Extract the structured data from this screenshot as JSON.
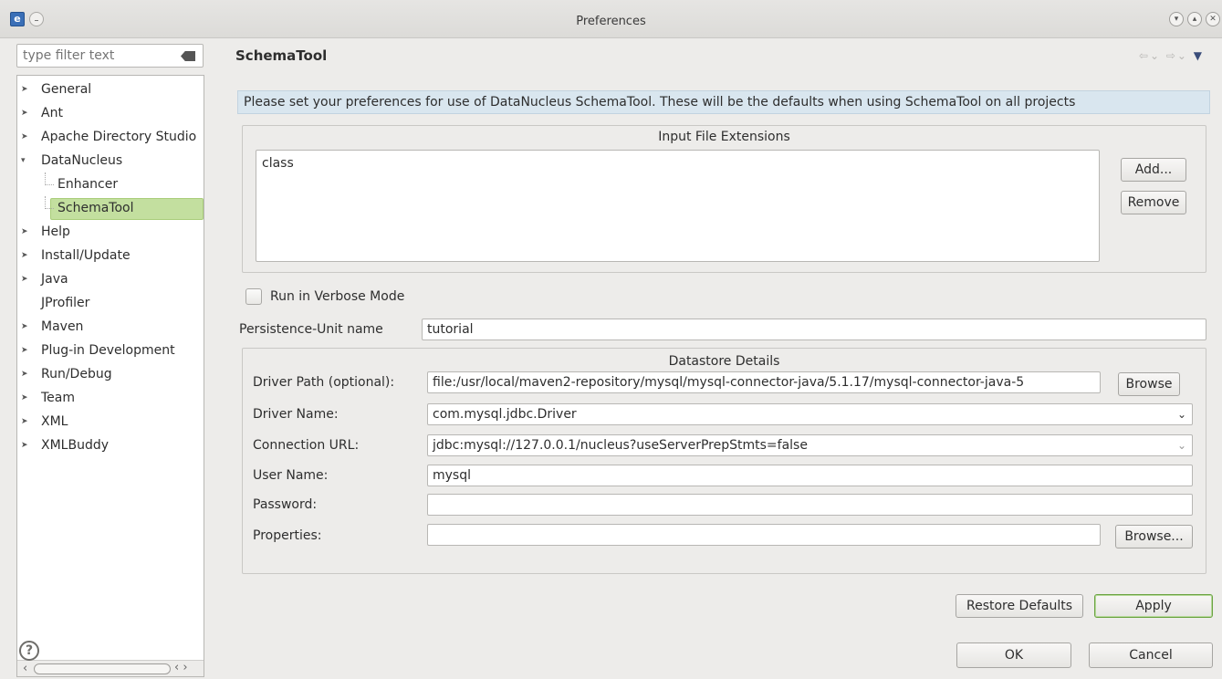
{
  "window": {
    "title": "Preferences"
  },
  "filter": {
    "placeholder": "type filter text"
  },
  "tree": {
    "items": [
      {
        "label": "General",
        "expanded": false
      },
      {
        "label": "Ant",
        "expanded": false
      },
      {
        "label": "Apache Directory Studio",
        "expanded": false
      },
      {
        "label": "DataNucleus",
        "expanded": true
      },
      {
        "label": "Enhancer",
        "child": true
      },
      {
        "label": "SchemaTool",
        "child": true,
        "selected": true
      },
      {
        "label": "Help",
        "expanded": false
      },
      {
        "label": "Install/Update",
        "expanded": false
      },
      {
        "label": "Java",
        "expanded": false
      },
      {
        "label": "JProfiler",
        "leaf": true
      },
      {
        "label": "Maven",
        "expanded": false
      },
      {
        "label": "Plug-in Development",
        "expanded": false
      },
      {
        "label": "Run/Debug",
        "expanded": false
      },
      {
        "label": "Team",
        "expanded": false
      },
      {
        "label": "XML",
        "expanded": false
      },
      {
        "label": "XMLBuddy",
        "expanded": false
      }
    ]
  },
  "page": {
    "title": "SchemaTool",
    "description": "Please set your preferences for use of DataNucleus SchemaTool. These will be the defaults when using SchemaTool on all projects",
    "input_extensions": {
      "title": "Input File Extensions",
      "items": [
        "class"
      ],
      "add_label": "Add...",
      "remove_label": "Remove"
    },
    "verbose_label": "Run in Verbose Mode",
    "persistence_unit": {
      "label": "Persistence-Unit name",
      "value": "tutorial"
    },
    "datastore": {
      "title": "Datastore Details",
      "driver_path": {
        "label": "Driver Path (optional):",
        "value": "file:/usr/local/maven2-repository/mysql/mysql-connector-java/5.1.17/mysql-connector-java-5",
        "browse_label": "Browse"
      },
      "driver_name": {
        "label": "Driver Name:",
        "value": "com.mysql.jdbc.Driver"
      },
      "connection_url": {
        "label": "Connection URL:",
        "value": "jdbc:mysql://127.0.0.1/nucleus?useServerPrepStmts=false"
      },
      "user_name": {
        "label": "User Name:",
        "value": "mysql"
      },
      "password": {
        "label": "Password:",
        "value": ""
      },
      "properties": {
        "label": "Properties:",
        "value": "",
        "browse_label": "Browse..."
      }
    },
    "restore_defaults_label": "Restore Defaults",
    "apply_label": "Apply"
  },
  "footer": {
    "ok_label": "OK",
    "cancel_label": "Cancel"
  }
}
